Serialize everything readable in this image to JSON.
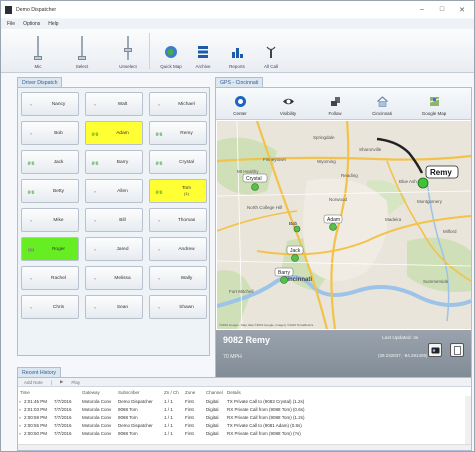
{
  "window": {
    "title": "Demo Dispatcher"
  },
  "window_controls": {
    "minimize": "–",
    "maximize": "□",
    "close": "✕"
  },
  "menu": [
    "File",
    "Options",
    "Help"
  ],
  "ribbon": {
    "sliders": [
      {
        "label": "Mic",
        "level": 0.0
      },
      {
        "label": "Select",
        "level": 0.0
      },
      {
        "label": "Unselect",
        "level": 0.4
      }
    ],
    "buttons": [
      {
        "label": "Quick Map",
        "icon": "globe-icon"
      },
      {
        "label": "Archive",
        "icon": "archive-icon"
      },
      {
        "label": "Reports",
        "icon": "reports-icon"
      },
      {
        "label": "All Call",
        "icon": "all-call-icon"
      }
    ]
  },
  "dispatch": {
    "tab": "Driver Dispatch",
    "cells": [
      {
        "name": "Nancy",
        "indicator": "»",
        "radio": false,
        "highlight": ""
      },
      {
        "name": "Walt",
        "indicator": "»",
        "radio": false,
        "highlight": ""
      },
      {
        "name": "Michael",
        "indicator": "»",
        "radio": false,
        "highlight": ""
      },
      {
        "name": "Bob",
        "indicator": "»",
        "radio": false,
        "highlight": ""
      },
      {
        "name": "Adam",
        "indicator": "((•))",
        "radio": true,
        "highlight": "yellow"
      },
      {
        "name": "Remy",
        "indicator": "((•))",
        "radio": true,
        "highlight": ""
      },
      {
        "name": "Jack",
        "indicator": "((•))",
        "radio": true,
        "highlight": ""
      },
      {
        "name": "Barry",
        "indicator": "((•))",
        "radio": true,
        "highlight": ""
      },
      {
        "name": "Crystal",
        "indicator": "((•))",
        "radio": true,
        "highlight": ""
      },
      {
        "name": "Betty",
        "indicator": "((•))",
        "radio": true,
        "highlight": ""
      },
      {
        "name": "Allen",
        "indicator": "»",
        "radio": false,
        "highlight": ""
      },
      {
        "name": "Tom",
        "sub": "(1)",
        "indicator": "((•))",
        "radio": true,
        "highlight": "yellow"
      },
      {
        "name": "Mike",
        "indicator": "»",
        "radio": false,
        "highlight": ""
      },
      {
        "name": "Bill",
        "indicator": "»",
        "radio": false,
        "highlight": ""
      },
      {
        "name": "Thomas",
        "indicator": "»",
        "radio": false,
        "highlight": ""
      },
      {
        "name": "Roger",
        "indicator": "▮▮▮",
        "radio": false,
        "highlight": "green"
      },
      {
        "name": "Jared",
        "indicator": "»",
        "radio": false,
        "highlight": ""
      },
      {
        "name": "Andrew",
        "indicator": "»",
        "radio": false,
        "highlight": ""
      },
      {
        "name": "Rachel",
        "indicator": "»",
        "radio": false,
        "highlight": ""
      },
      {
        "name": "Melissa",
        "indicator": "»",
        "radio": false,
        "highlight": ""
      },
      {
        "name": "Wally",
        "indicator": "»",
        "radio": false,
        "highlight": ""
      },
      {
        "name": "Chris",
        "indicator": "»",
        "radio": false,
        "highlight": ""
      },
      {
        "name": "Sean",
        "indicator": "»",
        "radio": false,
        "highlight": ""
      },
      {
        "name": "Shawn",
        "indicator": "»",
        "radio": false,
        "highlight": ""
      }
    ]
  },
  "gps": {
    "tab": "GPS - Cincinnati",
    "toolbar": [
      {
        "label": "Center",
        "icon": "center-icon"
      },
      {
        "label": "Visibility",
        "icon": "eye-icon"
      },
      {
        "label": "Follow",
        "icon": "follow-icon"
      },
      {
        "label": "Cincinnati",
        "icon": "home-icon"
      },
      {
        "label": "Google Map",
        "icon": "google-map-icon"
      }
    ],
    "map": {
      "places": [
        "Springdale",
        "Blue Ash",
        "Montgomery",
        "Madeira",
        "Norwood",
        "Fort Mitchell",
        "Cincinnati",
        "Milford",
        "Summerside",
        "Finneytown",
        "Sharonville",
        "Reading",
        "Wyoming",
        "Mt Healthy",
        "North College Hill"
      ],
      "markers": [
        {
          "label": "Remy",
          "selected": true
        },
        {
          "label": "Crystal",
          "selected": false
        },
        {
          "label": "Adam",
          "selected": false
        },
        {
          "label": "Jack",
          "selected": false
        },
        {
          "label": "Barry",
          "selected": false
        },
        {
          "label": "Bob",
          "selected": false
        }
      ],
      "attribution": "©2016 Google - Map data ©2016 Google, Imagery ©2016 TerraMetrics"
    },
    "info": {
      "unit": "9082 Remy",
      "speed": "70 MPH",
      "last_updated": "Last Updated: 4s",
      "coords": "(39.232837, -84.291409)"
    }
  },
  "history": {
    "tab": "Recent History",
    "toolbar": [
      "Add Note",
      "Play"
    ],
    "columns": [
      "Time",
      "Gateway",
      "Subscriber",
      "Zn / Ch",
      "Zone",
      "Channel",
      "Details"
    ],
    "rows": [
      {
        "time": "2:01:45 PM",
        "date": "7/7/2016",
        "gateway": "Motorola Conv",
        "subscriber": "Demo Dispatcher",
        "zn": "1 / 1",
        "zone": "First",
        "channel": "Digital",
        "details": "TX Private Call to (9083 Crystal) (1.2s)"
      },
      {
        "time": "2:01:03 PM",
        "date": "7/7/2016",
        "gateway": "Motorola Conv",
        "subscriber": "9088 Tom",
        "zn": "1 / 1",
        "zone": "First",
        "channel": "Digital",
        "details": "RX Private Call from (9088 Tom) (0.6s)"
      },
      {
        "time": "2:00:59 PM",
        "date": "7/7/2016",
        "gateway": "Motorola Conv",
        "subscriber": "9088 Tom",
        "zn": "1 / 1",
        "zone": "First",
        "channel": "Digital",
        "details": "RX Private Call from (9088 Tom) (1.2s)"
      },
      {
        "time": "2:00:55 PM",
        "date": "7/7/2016",
        "gateway": "Motorola Conv",
        "subscriber": "Demo Dispatcher",
        "zn": "1 / 1",
        "zone": "First",
        "channel": "Digital",
        "details": "TX Private Call to (9081 Adam) (0.8s)"
      },
      {
        "time": "2:00:50 PM",
        "date": "7/7/2016",
        "gateway": "Motorola Conv",
        "subscriber": "9088 Tom",
        "zn": "1 / 1",
        "zone": "First",
        "channel": "Digital",
        "details": "RX Private Call from (9088 Tom) (?s)"
      }
    ]
  },
  "colors": {
    "highlight_yellow": "#ffff33",
    "highlight_green": "#66ee22",
    "tab_text": "#35608f",
    "info_bar": "#8a939d"
  }
}
